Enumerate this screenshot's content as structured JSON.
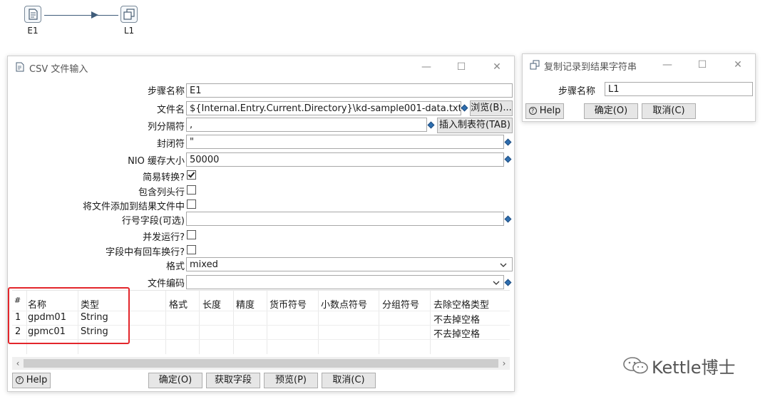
{
  "canvas": {
    "steps": [
      {
        "label": "E1"
      },
      {
        "label": "L1"
      }
    ]
  },
  "csv_dialog": {
    "title": "CSV 文件输入",
    "fields": {
      "step_name": {
        "label": "步骤名称",
        "value": "E1"
      },
      "filename": {
        "label": "文件名",
        "value": "${Internal.Entry.Current.Directory}\\kd-sample001-data.txt"
      },
      "delimiter": {
        "label": "列分隔符",
        "value": ","
      },
      "enclosure": {
        "label": "封闭符",
        "value": "\""
      },
      "nio_buffer": {
        "label": "NIO 缓存大小",
        "value": "50000"
      },
      "lazy_conversion": {
        "label": "简易转换?",
        "checked": true
      },
      "header_row": {
        "label": "包含列头行",
        "checked": false
      },
      "add_filename_to_result": {
        "label": "将文件添加到结果文件中",
        "checked": false
      },
      "row_number_field": {
        "label": "行号字段(可选)",
        "value": ""
      },
      "parallel": {
        "label": "并发运行?",
        "checked": false
      },
      "newline_in_field": {
        "label": "字段中有回车换行?",
        "checked": false
      },
      "format": {
        "label": "格式",
        "value": "mixed"
      },
      "encoding": {
        "label": "文件编码",
        "value": ""
      }
    },
    "buttons": {
      "browse": "浏览(B)...",
      "insert_tab": "插入制表符(TAB)",
      "help": "Help",
      "ok": "确定(O)",
      "get_fields": "获取字段",
      "preview": "预览(P)",
      "cancel": "取消(C)"
    },
    "table": {
      "columns": [
        "#",
        "名称",
        "类型",
        "格式",
        "长度",
        "精度",
        "货币符号",
        "小数点符号",
        "分组符号",
        "去除空格类型"
      ],
      "rows": [
        {
          "num": "1",
          "name": "gpdm01",
          "type": "String",
          "trim": "不去掉空格"
        },
        {
          "num": "2",
          "name": "gpmc01",
          "type": "String",
          "trim": "不去掉空格"
        }
      ]
    }
  },
  "copy_dialog": {
    "title": "复制记录到结果字符串",
    "step_name": {
      "label": "步骤名称",
      "value": "L1"
    },
    "buttons": {
      "help": "Help",
      "ok": "确定(O)",
      "cancel": "取消(C)"
    }
  },
  "watermark": {
    "text": "Kettle博士",
    "icon": "wechat-icon"
  },
  "colors": {
    "highlight_box": "#e3262b",
    "accent": "#2f6fb0"
  }
}
